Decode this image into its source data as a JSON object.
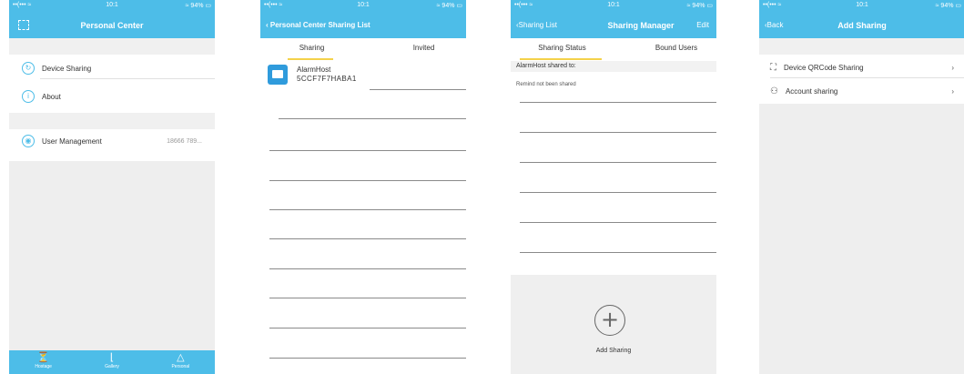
{
  "status": {
    "left": "••(••• ≈",
    "time": "10:1",
    "right": "≈ 94% ▭"
  },
  "screen1": {
    "title": "Personal Center",
    "menu": [
      {
        "label": "Device Sharing",
        "icon": "share-icon"
      },
      {
        "label": "About",
        "icon": "info-icon"
      }
    ],
    "user": {
      "label": "User Management",
      "value": "18666 789..."
    },
    "tabs": [
      {
        "label": "Hostage",
        "icon": "host-icon"
      },
      {
        "label": "Gallery",
        "icon": "gallery-icon"
      },
      {
        "label": "Personal",
        "icon": "person-icon"
      }
    ]
  },
  "screen2": {
    "back": "Personal Center Sharing List",
    "tabs": [
      "Sharing",
      "Invited"
    ],
    "device": {
      "name": "AlarmHost",
      "id": "5CCF7F7HABA1"
    }
  },
  "screen3": {
    "back": "Sharing List",
    "title": "Sharing Manager",
    "right": "Edit",
    "tabs": [
      "Sharing Status",
      "Bound Users"
    ],
    "shared": "AlarmHost shared to:",
    "note": "Remind not been shared",
    "add": "Add Sharing"
  },
  "screen4": {
    "back": "Back",
    "title": "Add Sharing",
    "items": [
      {
        "label": "Device QRCode Sharing",
        "icon": "qr-icon"
      },
      {
        "label": "Account sharing",
        "icon": "account-icon"
      }
    ]
  },
  "colors": {
    "accent": "#4dbde8",
    "tab_underline": "#f4d24a"
  }
}
